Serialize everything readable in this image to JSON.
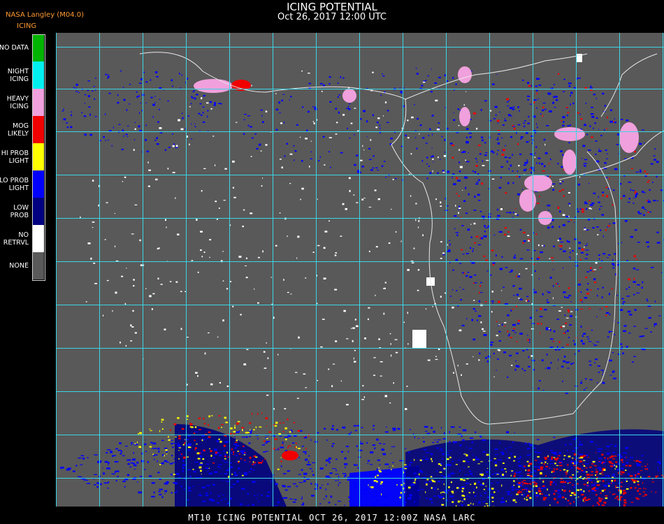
{
  "header": {
    "agency": "NASA Langley (M04.0)",
    "product": "ICING",
    "title": "ICING POTENTIAL",
    "datetime": "Oct 26, 2017 12:00 UTC"
  },
  "legend": {
    "items": [
      {
        "label": "NO DATA",
        "color": "#00b400"
      },
      {
        "label": "NIGHT\nICING",
        "color": "#00f0f0"
      },
      {
        "label": "HEAVY\nICING",
        "color": "#f0a0dc"
      },
      {
        "label": "MOG\nLIKELY",
        "color": "#f00000"
      },
      {
        "label": "HI PROB\nLIGHT",
        "color": "#ffff00"
      },
      {
        "label": "LO PROB\nLIGHT",
        "color": "#0000ff"
      },
      {
        "label": "LOW\nPROB",
        "color": "#000080"
      },
      {
        "label": "NO\nRETRVL",
        "color": "#ffffff"
      },
      {
        "label": "NONE",
        "color": "#595959"
      }
    ]
  },
  "map": {
    "background_color": "#595959",
    "grid_color": "#3ad6e6",
    "label_color": "#c83232",
    "coast_color": "#e8e8e8"
  },
  "footer": {
    "text": "MT10  ICING POTENTIAL   OCT 26, 2017 12:00Z   NASA LARC"
  }
}
